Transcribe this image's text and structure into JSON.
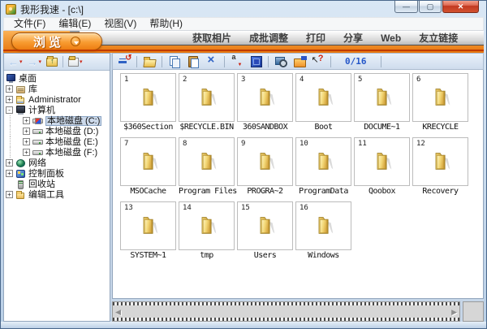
{
  "window": {
    "title": "我形我速 - [c:\\]",
    "controls": {
      "minimize": "—",
      "maximize": "▢",
      "close": "✕"
    }
  },
  "menu_bar": {
    "items": [
      {
        "id": "file",
        "label": "文件(F)"
      },
      {
        "id": "edit",
        "label": "编辑(E)"
      },
      {
        "id": "view",
        "label": "视图(V)"
      },
      {
        "id": "help",
        "label": "帮助(H)"
      }
    ]
  },
  "mode_bar": {
    "browse_label": "浏览",
    "tabs": [
      {
        "id": "acquire-photo",
        "label": "获取相片"
      },
      {
        "id": "batch-adjust",
        "label": "成批调整"
      },
      {
        "id": "print",
        "label": "打印"
      },
      {
        "id": "share",
        "label": "分享"
      },
      {
        "id": "web",
        "label": "Web"
      },
      {
        "id": "ulead-links",
        "label": "友立链接"
      }
    ]
  },
  "sidebar": {
    "nav_icons": [
      "back",
      "forward",
      "up-folder",
      "separator",
      "folder-views"
    ],
    "tree": [
      {
        "id": "desktop",
        "label": "桌面",
        "icon": "desktop",
        "expander": "hidden",
        "level": 0,
        "selected": false
      },
      {
        "id": "libraries",
        "label": "库",
        "icon": "libraries",
        "expander": "plus",
        "level": 0,
        "selected": false
      },
      {
        "id": "administrator",
        "label": "Administrator",
        "icon": "user-folder",
        "expander": "plus",
        "level": 0,
        "selected": false
      },
      {
        "id": "computer",
        "label": "计算机",
        "icon": "computer",
        "expander": "minus",
        "level": 0,
        "selected": false
      },
      {
        "id": "drive-c",
        "label": "本地磁盘 (C:)",
        "icon": "drive-system",
        "expander": "plus",
        "level": 1,
        "selected": true
      },
      {
        "id": "drive-d",
        "label": "本地磁盘 (D:)",
        "icon": "drive",
        "expander": "plus",
        "level": 1,
        "selected": false
      },
      {
        "id": "drive-e",
        "label": "本地磁盘 (E:)",
        "icon": "drive",
        "expander": "plus",
        "level": 1,
        "selected": false
      },
      {
        "id": "drive-f",
        "label": "本地磁盘 (F:)",
        "icon": "drive",
        "expander": "plus",
        "level": 1,
        "selected": false
      },
      {
        "id": "network",
        "label": "网络",
        "icon": "network",
        "expander": "plus",
        "level": 0,
        "selected": false
      },
      {
        "id": "control-panel",
        "label": "控制面板",
        "icon": "control-panel",
        "expander": "plus",
        "level": 0,
        "selected": false
      },
      {
        "id": "recycle-bin",
        "label": "回收站",
        "icon": "recycle-bin",
        "expander": "blank",
        "level": 0,
        "selected": false
      },
      {
        "id": "edit-tools",
        "label": "编辑工具",
        "icon": "tools-folder",
        "expander": "plus",
        "level": 0,
        "selected": false
      }
    ]
  },
  "toolbar": {
    "buttons": [
      "thumbnail-size",
      "separator",
      "open-folder",
      "separator",
      "copy",
      "paste",
      "delete",
      "separator",
      "sort",
      "select-all",
      "separator",
      "preview",
      "acquire-folder",
      "help-pointer",
      "separator",
      "counter",
      "separator"
    ],
    "counter": "0/16"
  },
  "folders": [
    {
      "num": "1",
      "name": "$360Section"
    },
    {
      "num": "2",
      "name": "$RECYCLE.BIN"
    },
    {
      "num": "3",
      "name": "360SANDBOX"
    },
    {
      "num": "4",
      "name": "Boot"
    },
    {
      "num": "5",
      "name": "DOCUME~1"
    },
    {
      "num": "6",
      "name": "KRECYCLE"
    },
    {
      "num": "7",
      "name": "MSOCache"
    },
    {
      "num": "8",
      "name": "Program Files"
    },
    {
      "num": "9",
      "name": "PROGRA~2"
    },
    {
      "num": "10",
      "name": "ProgramData"
    },
    {
      "num": "11",
      "name": "Qoobox"
    },
    {
      "num": "12",
      "name": "Recovery"
    },
    {
      "num": "13",
      "name": "SYSTEM~1"
    },
    {
      "num": "14",
      "name": "tmp"
    },
    {
      "num": "15",
      "name": "Users"
    },
    {
      "num": "16",
      "name": "Windows"
    }
  ],
  "filmstrip": {
    "left_arrow": "◀",
    "right_arrow": "▶"
  },
  "colors": {
    "accent_orange": "#ed7d12",
    "counter_blue": "#2456c8",
    "close_red": "#c23a22",
    "folder_yellow": "#e8bb4a"
  }
}
